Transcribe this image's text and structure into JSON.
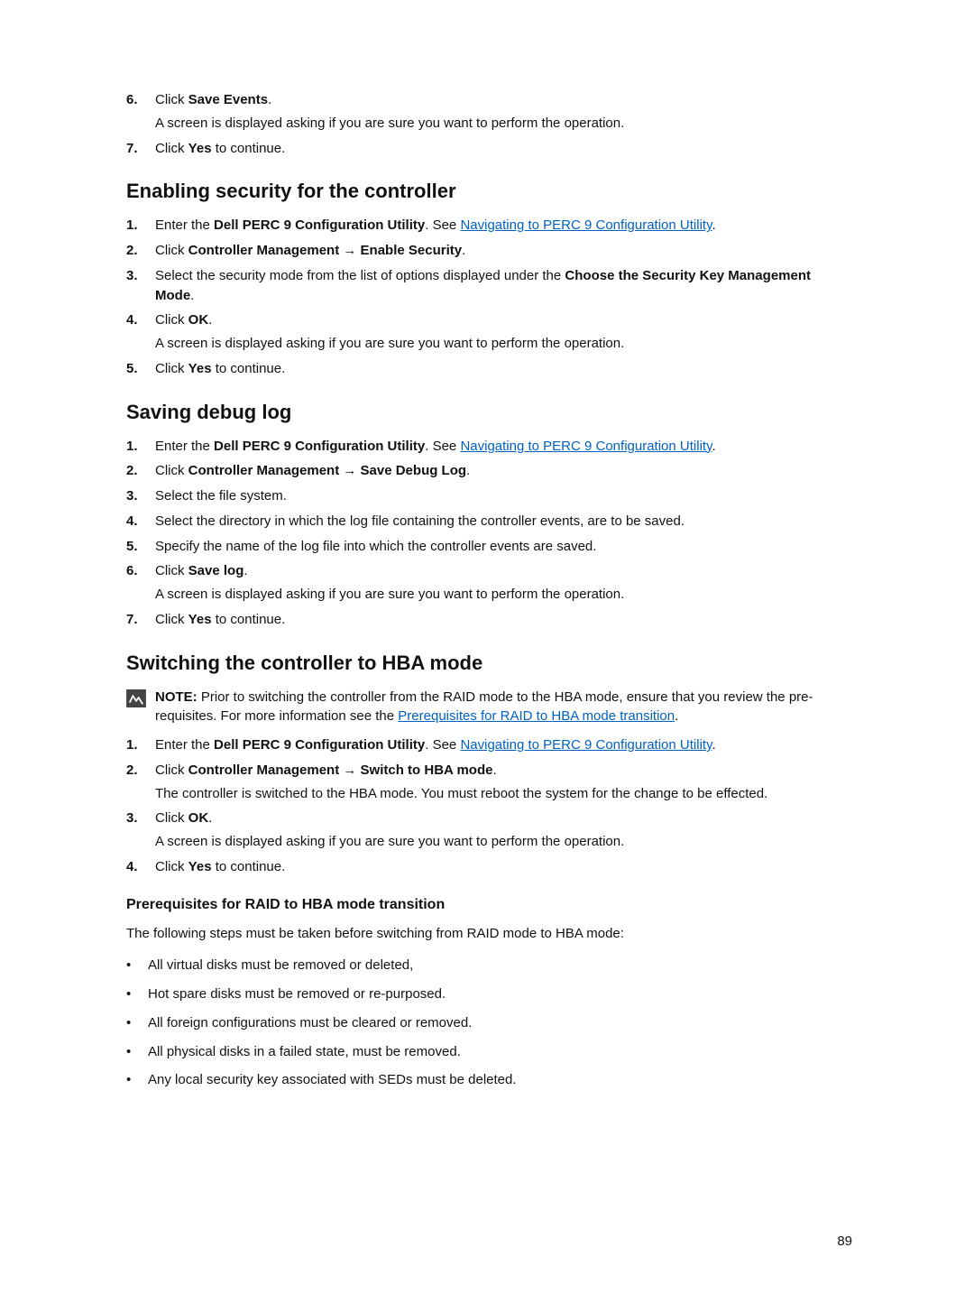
{
  "intro_steps": [
    {
      "n": "6.",
      "parts": [
        {
          "t": "Click "
        },
        {
          "t": "Save Events",
          "bold": true
        },
        {
          "t": "."
        }
      ],
      "sub": "A screen is displayed asking if you are sure you want to perform the operation."
    },
    {
      "n": "7.",
      "parts": [
        {
          "t": "Click "
        },
        {
          "t": "Yes",
          "bold": true
        },
        {
          "t": " to continue."
        }
      ]
    }
  ],
  "sec1_title": "Enabling security for the controller",
  "sec1_steps": [
    {
      "n": "1.",
      "parts": [
        {
          "t": "Enter the "
        },
        {
          "t": "Dell PERC 9 Configuration Utility",
          "bold": true
        },
        {
          "t": ". See "
        },
        {
          "t": "Navigating to PERC 9 Configuration Utility",
          "link": true
        },
        {
          "t": "."
        }
      ]
    },
    {
      "n": "2.",
      "parts": [
        {
          "t": "Click "
        },
        {
          "t": "Controller Management → Enable Security",
          "bold": true
        },
        {
          "t": "."
        }
      ]
    },
    {
      "n": "3.",
      "parts": [
        {
          "t": "Select the security mode from the list of options displayed under the "
        },
        {
          "t": "Choose the Security Key Management Mode",
          "bold": true
        },
        {
          "t": "."
        }
      ]
    },
    {
      "n": "4.",
      "parts": [
        {
          "t": "Click "
        },
        {
          "t": "OK",
          "bold": true
        },
        {
          "t": "."
        }
      ],
      "sub": "A screen is displayed asking if you are sure you want to perform the operation."
    },
    {
      "n": "5.",
      "parts": [
        {
          "t": "Click "
        },
        {
          "t": "Yes",
          "bold": true
        },
        {
          "t": " to continue."
        }
      ]
    }
  ],
  "sec2_title": "Saving debug log",
  "sec2_steps": [
    {
      "n": "1.",
      "parts": [
        {
          "t": "Enter the "
        },
        {
          "t": "Dell PERC 9 Configuration Utility",
          "bold": true
        },
        {
          "t": ". See "
        },
        {
          "t": "Navigating to PERC 9 Configuration Utility",
          "link": true
        },
        {
          "t": "."
        }
      ]
    },
    {
      "n": "2.",
      "parts": [
        {
          "t": "Click "
        },
        {
          "t": "Controller Management → Save Debug Log",
          "bold": true
        },
        {
          "t": "."
        }
      ]
    },
    {
      "n": "3.",
      "parts": [
        {
          "t": "Select the file system."
        }
      ]
    },
    {
      "n": "4.",
      "parts": [
        {
          "t": "Select the directory in which the log file containing the controller events, are to be saved."
        }
      ]
    },
    {
      "n": "5.",
      "parts": [
        {
          "t": "Specify the name of the log file into which the controller events are saved."
        }
      ]
    },
    {
      "n": "6.",
      "parts": [
        {
          "t": "Click "
        },
        {
          "t": "Save log",
          "bold": true
        },
        {
          "t": "."
        }
      ],
      "sub": "A screen is displayed asking if you are sure you want to perform the operation."
    },
    {
      "n": "7.",
      "parts": [
        {
          "t": "Click "
        },
        {
          "t": "Yes",
          "bold": true
        },
        {
          "t": " to continue."
        }
      ]
    }
  ],
  "sec3_title": "Switching the controller to HBA mode",
  "sec3_note_parts": [
    {
      "t": "NOTE: ",
      "bold": true
    },
    {
      "t": "Prior to switching the controller from the RAID mode to the HBA mode, ensure that you review the pre-requisites. For more information see the "
    },
    {
      "t": "Prerequisites for RAID to HBA mode transition",
      "link": true
    },
    {
      "t": "."
    }
  ],
  "sec3_steps": [
    {
      "n": "1.",
      "parts": [
        {
          "t": "Enter the "
        },
        {
          "t": "Dell PERC 9 Configuration Utility",
          "bold": true
        },
        {
          "t": ". See "
        },
        {
          "t": "Navigating to PERC 9 Configuration Utility",
          "link": true
        },
        {
          "t": "."
        }
      ]
    },
    {
      "n": "2.",
      "parts": [
        {
          "t": "Click "
        },
        {
          "t": "Controller Management → Switch to HBA mode",
          "bold": true
        },
        {
          "t": "."
        }
      ],
      "sub": "The controller is switched to the HBA mode. You must reboot the system for the change to be effected."
    },
    {
      "n": "3.",
      "parts": [
        {
          "t": "Click "
        },
        {
          "t": "OK",
          "bold": true
        },
        {
          "t": "."
        }
      ],
      "sub": "A screen is displayed asking if you are sure you want to perform the operation."
    },
    {
      "n": "4.",
      "parts": [
        {
          "t": "Click "
        },
        {
          "t": "Yes",
          "bold": true
        },
        {
          "t": " to continue."
        }
      ]
    }
  ],
  "sec4_title": "Prerequisites for RAID to HBA mode transition",
  "sec4_intro": "The following steps must be taken before switching from RAID mode to HBA mode:",
  "sec4_bullets": [
    "All virtual disks must be removed or deleted,",
    "Hot spare disks must be removed or re-purposed.",
    "All foreign configurations must be cleared or removed.",
    "All physical disks in a failed state, must be removed.",
    "Any local security key associated with SEDs must be deleted."
  ],
  "page_number": "89"
}
